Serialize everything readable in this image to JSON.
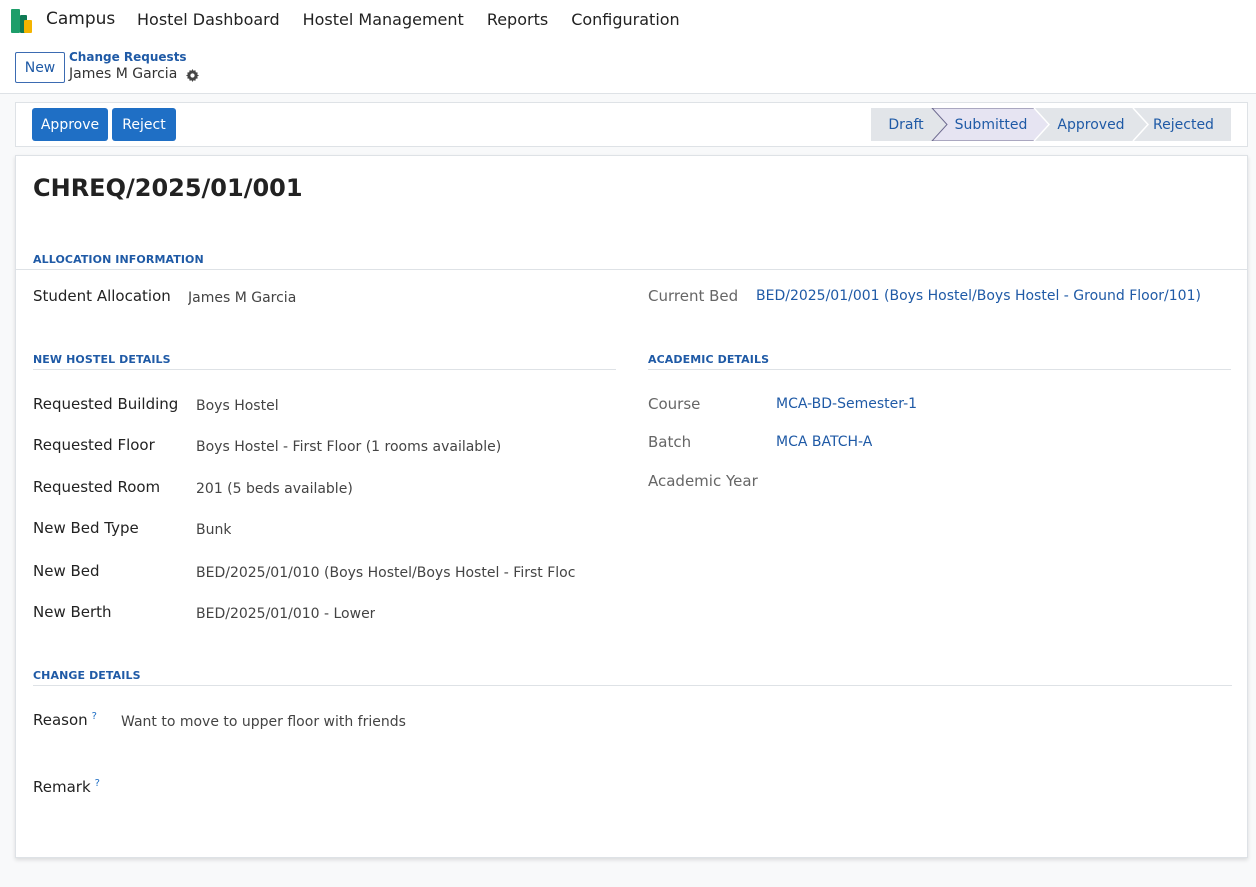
{
  "navbar": {
    "app_name": "Campus",
    "menu": [
      "Hostel Dashboard",
      "Hostel Management",
      "Reports",
      "Configuration"
    ]
  },
  "control_panel": {
    "new_label": "New",
    "breadcrumb_parent": "Change Requests",
    "breadcrumb_current": "James M Garcia"
  },
  "statusbar": {
    "approve_label": "Approve",
    "reject_label": "Reject",
    "stages": [
      "Draft",
      "Submitted",
      "Approved",
      "Rejected"
    ],
    "active_stage": "Submitted"
  },
  "form": {
    "title": "CHREQ/2025/01/001",
    "allocation": {
      "section_title": "ALLOCATION INFORMATION",
      "student_allocation_label": "Student Allocation",
      "student_allocation_value": "James M Garcia",
      "current_bed_label": "Current Bed",
      "current_bed_value": "BED/2025/01/001 (Boys Hostel/Boys Hostel - Ground Floor/101)"
    },
    "new_hostel": {
      "section_title": "NEW HOSTEL DETAILS",
      "fields": [
        {
          "label": "Requested Building",
          "value": "Boys Hostel"
        },
        {
          "label": "Requested Floor",
          "value": "Boys Hostel - First Floor (1 rooms available)"
        },
        {
          "label": "Requested Room",
          "value": "201 (5 beds available)"
        },
        {
          "label": "New Bed Type",
          "value": "Bunk"
        },
        {
          "label": "New Bed",
          "value": "BED/2025/01/010 (Boys Hostel/Boys Hostel - First Floc"
        },
        {
          "label": "New Berth",
          "value": "BED/2025/01/010 - Lower"
        }
      ]
    },
    "academic": {
      "section_title": "ACADEMIC DETAILS",
      "fields": [
        {
          "label": "Course",
          "value": "MCA-BD-Semester-1"
        },
        {
          "label": "Batch",
          "value": "MCA BATCH-A"
        },
        {
          "label": "Academic Year",
          "value": ""
        }
      ]
    },
    "change": {
      "section_title": "CHANGE DETAILS",
      "reason_label": "Reason",
      "reason_value": "Want to move to upper floor with friends",
      "remark_label": "Remark",
      "remark_value": "",
      "help_mark": "?"
    }
  },
  "colors": {
    "primary": "#1f6fc5",
    "link": "#1f5aa6",
    "active_stage_bg": "#e6e4f2",
    "stage_bg": "#e2e5e9"
  },
  "icons": {
    "logo": "campus-logo",
    "settings": "gear-icon"
  }
}
